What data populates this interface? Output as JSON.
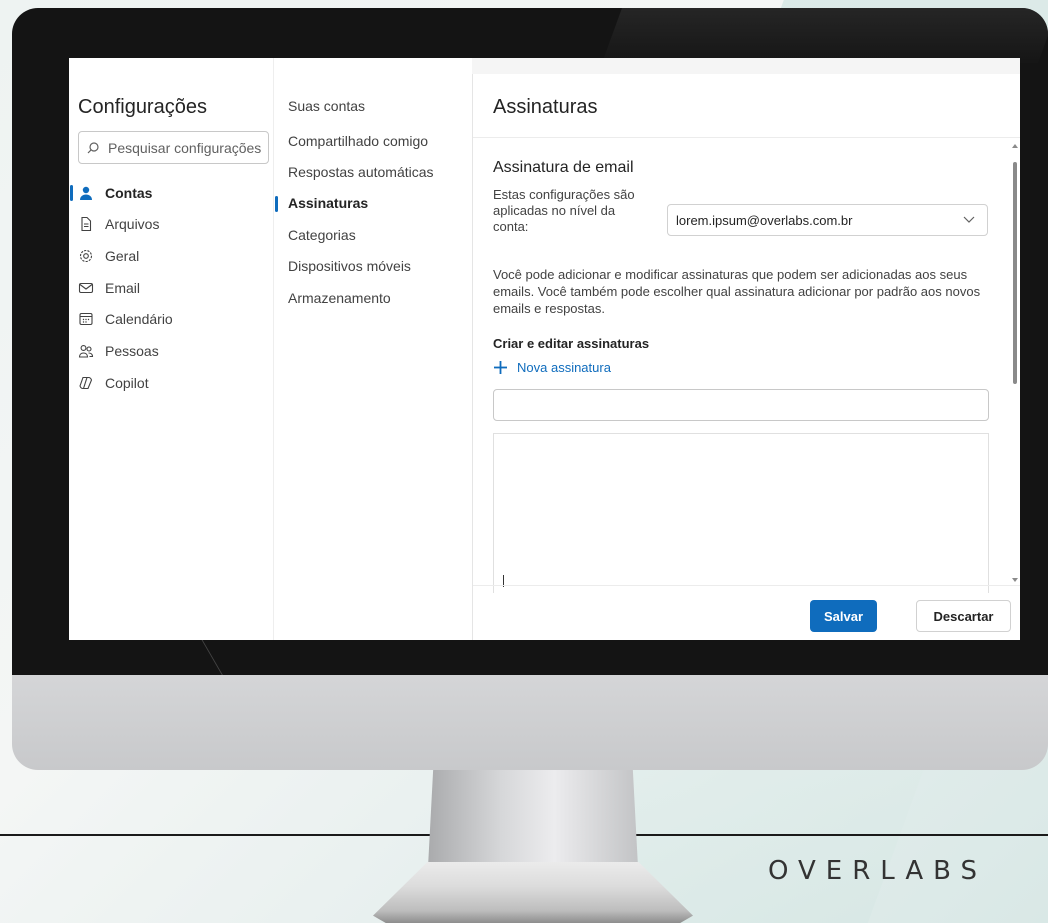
{
  "settings": {
    "title": "Configurações",
    "search_placeholder": "Pesquisar configurações",
    "nav": [
      {
        "label": "Contas",
        "icon": "person-icon",
        "selected": true
      },
      {
        "label": "Arquivos",
        "icon": "file-icon",
        "selected": false
      },
      {
        "label": "Geral",
        "icon": "gear-icon",
        "selected": false
      },
      {
        "label": "Email",
        "icon": "mail-icon",
        "selected": false
      },
      {
        "label": "Calendário",
        "icon": "calendar-icon",
        "selected": false
      },
      {
        "label": "Pessoas",
        "icon": "people-icon",
        "selected": false
      },
      {
        "label": "Copilot",
        "icon": "copilot-icon",
        "selected": false
      }
    ],
    "subnav": [
      {
        "label": "Suas contas",
        "selected": false
      },
      {
        "label": "Compartilhado comigo",
        "selected": false
      },
      {
        "label": "Respostas automáticas",
        "selected": false
      },
      {
        "label": "Assinaturas",
        "selected": true
      },
      {
        "label": "Categorias",
        "selected": false
      },
      {
        "label": "Dispositivos móveis",
        "selected": false
      },
      {
        "label": "Armazenamento",
        "selected": false
      }
    ]
  },
  "panel": {
    "title": "Assinaturas",
    "section_title": "Assinatura de email",
    "scope_text": "Estas configurações são aplicadas no nível da conta:",
    "account_value": "lorem.ipsum@overlabs.com.br",
    "description": "Você pode adicionar e modificar assinaturas que podem ser adicionadas aos seus emails. Você também pode escolher qual assinatura adicionar por padrão aos novos emails e respostas.",
    "create_edit_label": "Criar e editar assinaturas",
    "new_signature_label": "Nova assinatura",
    "signature_name_value": "",
    "save_label": "Salvar",
    "discard_label": "Descartar"
  },
  "brand": {
    "logo_text": "OVERLABS",
    "accent": "#0f6cbd"
  }
}
